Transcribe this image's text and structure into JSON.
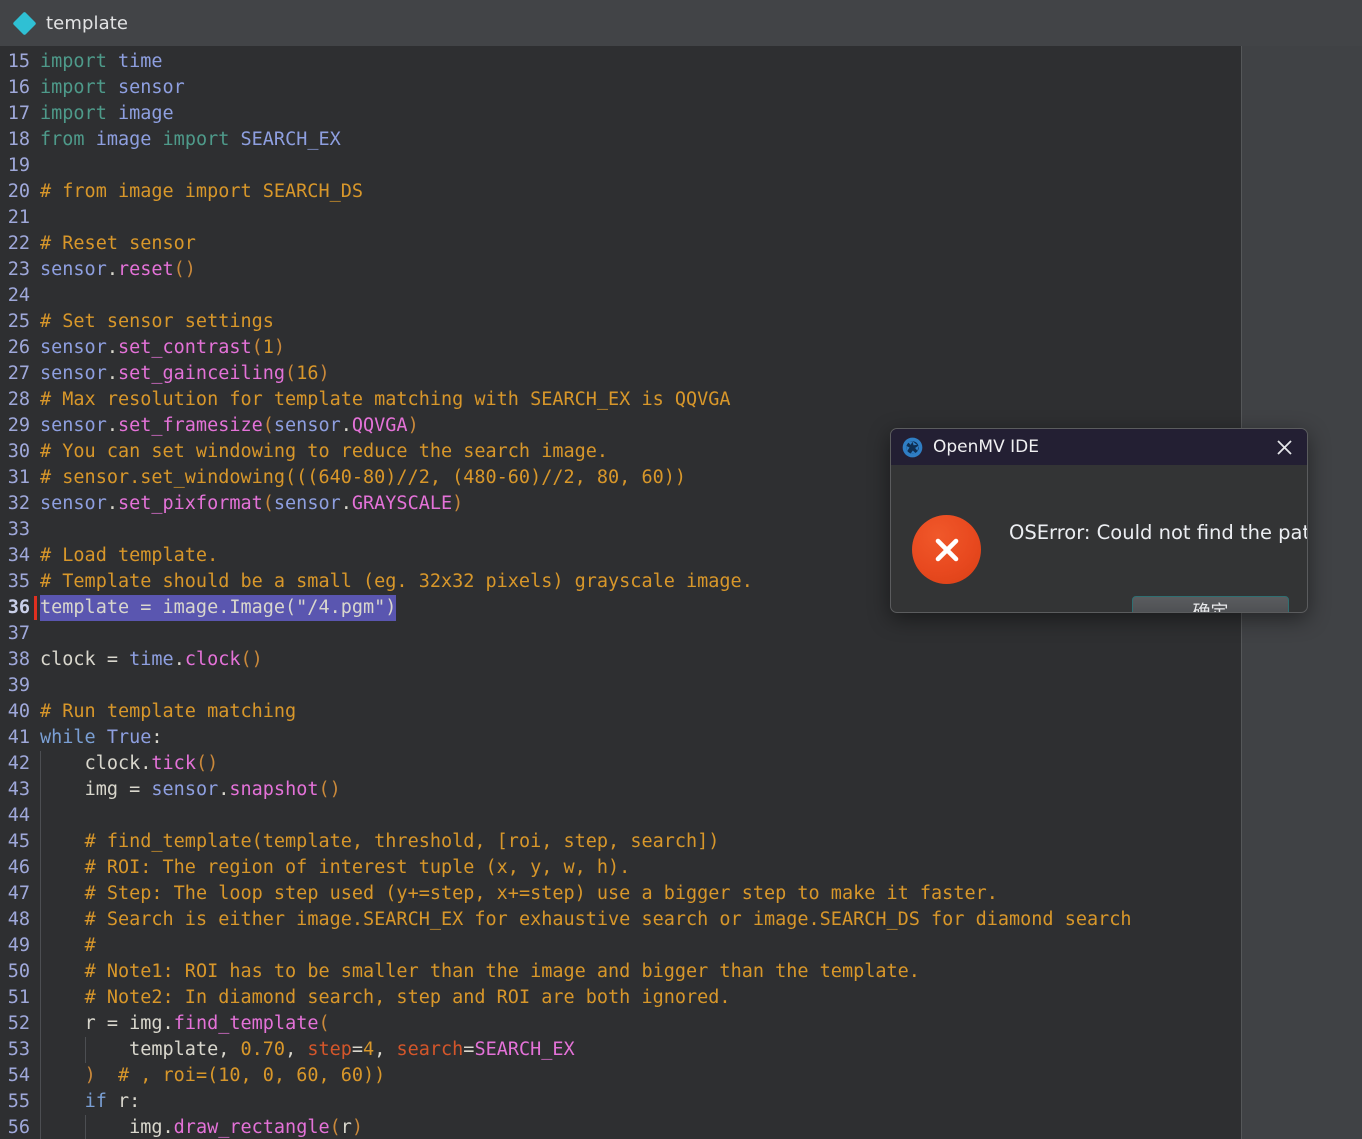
{
  "tab": {
    "label": "template",
    "icon": "diamond-icon",
    "accent_color": "#2fc0d4"
  },
  "editor": {
    "first_line_number": 15,
    "current_line": 36,
    "selection_color": "#5a56b0",
    "background": "#2e2f31",
    "lines": [
      {
        "n": 15,
        "tokens": [
          {
            "t": "import",
            "c": "t-kw"
          },
          {
            "t": " ",
            "c": "t-plain"
          },
          {
            "t": "time",
            "c": "t-mod"
          }
        ]
      },
      {
        "n": 16,
        "tokens": [
          {
            "t": "import",
            "c": "t-kw"
          },
          {
            "t": " ",
            "c": "t-plain"
          },
          {
            "t": "sensor",
            "c": "t-mod"
          }
        ]
      },
      {
        "n": 17,
        "tokens": [
          {
            "t": "import",
            "c": "t-kw"
          },
          {
            "t": " ",
            "c": "t-plain"
          },
          {
            "t": "image",
            "c": "t-mod"
          }
        ]
      },
      {
        "n": 18,
        "tokens": [
          {
            "t": "from",
            "c": "t-kw"
          },
          {
            "t": " ",
            "c": "t-plain"
          },
          {
            "t": "image",
            "c": "t-mod"
          },
          {
            "t": " ",
            "c": "t-plain"
          },
          {
            "t": "import",
            "c": "t-kw"
          },
          {
            "t": " ",
            "c": "t-plain"
          },
          {
            "t": "SEARCH_EX",
            "c": "t-mod"
          }
        ]
      },
      {
        "n": 19,
        "tokens": []
      },
      {
        "n": 20,
        "tokens": [
          {
            "t": "# from image import SEARCH_DS",
            "c": "t-com"
          }
        ]
      },
      {
        "n": 21,
        "tokens": []
      },
      {
        "n": 22,
        "tokens": [
          {
            "t": "# Reset sensor",
            "c": "t-com"
          }
        ]
      },
      {
        "n": 23,
        "tokens": [
          {
            "t": "sensor",
            "c": "t-mod"
          },
          {
            "t": ".",
            "c": "t-plain"
          },
          {
            "t": "reset",
            "c": "t-meth"
          },
          {
            "t": "()",
            "c": "t-punc"
          }
        ]
      },
      {
        "n": 24,
        "tokens": []
      },
      {
        "n": 25,
        "tokens": [
          {
            "t": "# Set sensor settings",
            "c": "t-com"
          }
        ]
      },
      {
        "n": 26,
        "tokens": [
          {
            "t": "sensor",
            "c": "t-mod"
          },
          {
            "t": ".",
            "c": "t-plain"
          },
          {
            "t": "set_contrast",
            "c": "t-meth"
          },
          {
            "t": "(",
            "c": "t-punc"
          },
          {
            "t": "1",
            "c": "t-num"
          },
          {
            "t": ")",
            "c": "t-punc"
          }
        ]
      },
      {
        "n": 27,
        "tokens": [
          {
            "t": "sensor",
            "c": "t-mod"
          },
          {
            "t": ".",
            "c": "t-plain"
          },
          {
            "t": "set_gainceiling",
            "c": "t-meth"
          },
          {
            "t": "(",
            "c": "t-punc"
          },
          {
            "t": "16",
            "c": "t-num"
          },
          {
            "t": ")",
            "c": "t-punc"
          }
        ]
      },
      {
        "n": 28,
        "tokens": [
          {
            "t": "# Max resolution for template matching with SEARCH_EX is QQVGA",
            "c": "t-com"
          }
        ]
      },
      {
        "n": 29,
        "tokens": [
          {
            "t": "sensor",
            "c": "t-mod"
          },
          {
            "t": ".",
            "c": "t-plain"
          },
          {
            "t": "set_framesize",
            "c": "t-meth"
          },
          {
            "t": "(",
            "c": "t-punc"
          },
          {
            "t": "sensor",
            "c": "t-mod"
          },
          {
            "t": ".",
            "c": "t-plain"
          },
          {
            "t": "QQVGA",
            "c": "t-const"
          },
          {
            "t": ")",
            "c": "t-punc"
          }
        ]
      },
      {
        "n": 30,
        "tokens": [
          {
            "t": "# You can set windowing to reduce the search image.",
            "c": "t-com"
          }
        ]
      },
      {
        "n": 31,
        "tokens": [
          {
            "t": "# sensor.set_windowing(((640-80)//2, (480-60)//2, 80, 60))",
            "c": "t-com"
          }
        ]
      },
      {
        "n": 32,
        "tokens": [
          {
            "t": "sensor",
            "c": "t-mod"
          },
          {
            "t": ".",
            "c": "t-plain"
          },
          {
            "t": "set_pixformat",
            "c": "t-meth"
          },
          {
            "t": "(",
            "c": "t-punc"
          },
          {
            "t": "sensor",
            "c": "t-mod"
          },
          {
            "t": ".",
            "c": "t-plain"
          },
          {
            "t": "GRAYSCALE",
            "c": "t-const"
          },
          {
            "t": ")",
            "c": "t-punc"
          }
        ]
      },
      {
        "n": 33,
        "tokens": []
      },
      {
        "n": 34,
        "tokens": [
          {
            "t": "# Load template.",
            "c": "t-com"
          }
        ]
      },
      {
        "n": 35,
        "tokens": [
          {
            "t": "# Template should be a small (eg. 32x32 pixels) grayscale image.",
            "c": "t-com"
          }
        ]
      },
      {
        "n": 36,
        "selected": true,
        "tokens": [
          {
            "t": "template = image.Image(\"/4.pgm\")",
            "c": "t-plain"
          }
        ]
      },
      {
        "n": 37,
        "tokens": []
      },
      {
        "n": 38,
        "tokens": [
          {
            "t": "clock",
            "c": "t-var"
          },
          {
            "t": " = ",
            "c": "t-op"
          },
          {
            "t": "time",
            "c": "t-mod"
          },
          {
            "t": ".",
            "c": "t-plain"
          },
          {
            "t": "clock",
            "c": "t-meth"
          },
          {
            "t": "()",
            "c": "t-punc"
          }
        ]
      },
      {
        "n": 39,
        "tokens": []
      },
      {
        "n": 40,
        "tokens": [
          {
            "t": "# Run template matching",
            "c": "t-com"
          }
        ]
      },
      {
        "n": 41,
        "tokens": [
          {
            "t": "while",
            "c": "t-kw2"
          },
          {
            "t": " ",
            "c": "t-plain"
          },
          {
            "t": "True",
            "c": "t-bi"
          },
          {
            "t": ":",
            "c": "t-plain"
          }
        ]
      },
      {
        "n": 42,
        "indent": 1,
        "tokens": [
          {
            "t": "    ",
            "c": "t-plain"
          },
          {
            "t": "clock",
            "c": "t-var"
          },
          {
            "t": ".",
            "c": "t-plain"
          },
          {
            "t": "tick",
            "c": "t-meth"
          },
          {
            "t": "()",
            "c": "t-punc"
          }
        ]
      },
      {
        "n": 43,
        "indent": 1,
        "tokens": [
          {
            "t": "    ",
            "c": "t-plain"
          },
          {
            "t": "img",
            "c": "t-var"
          },
          {
            "t": " = ",
            "c": "t-op"
          },
          {
            "t": "sensor",
            "c": "t-mod"
          },
          {
            "t": ".",
            "c": "t-plain"
          },
          {
            "t": "snapshot",
            "c": "t-meth"
          },
          {
            "t": "()",
            "c": "t-punc"
          }
        ]
      },
      {
        "n": 44,
        "indent": 1,
        "tokens": []
      },
      {
        "n": 45,
        "indent": 1,
        "tokens": [
          {
            "t": "    ",
            "c": "t-plain"
          },
          {
            "t": "# find_template(template, threshold, [roi, step, search])",
            "c": "t-com"
          }
        ]
      },
      {
        "n": 46,
        "indent": 1,
        "tokens": [
          {
            "t": "    ",
            "c": "t-plain"
          },
          {
            "t": "# ROI: The region of interest tuple (x, y, w, h).",
            "c": "t-com"
          }
        ]
      },
      {
        "n": 47,
        "indent": 1,
        "tokens": [
          {
            "t": "    ",
            "c": "t-plain"
          },
          {
            "t": "# Step: The loop step used (y+=step, x+=step) use a bigger step to make it faster.",
            "c": "t-com"
          }
        ]
      },
      {
        "n": 48,
        "indent": 1,
        "tokens": [
          {
            "t": "    ",
            "c": "t-plain"
          },
          {
            "t": "# Search is either image.SEARCH_EX for exhaustive search or image.SEARCH_DS for diamond search",
            "c": "t-com"
          }
        ]
      },
      {
        "n": 49,
        "indent": 1,
        "tokens": [
          {
            "t": "    ",
            "c": "t-plain"
          },
          {
            "t": "#",
            "c": "t-com"
          }
        ]
      },
      {
        "n": 50,
        "indent": 1,
        "tokens": [
          {
            "t": "    ",
            "c": "t-plain"
          },
          {
            "t": "# Note1: ROI has to be smaller than the image and bigger than the template.",
            "c": "t-com"
          }
        ]
      },
      {
        "n": 51,
        "indent": 1,
        "tokens": [
          {
            "t": "    ",
            "c": "t-plain"
          },
          {
            "t": "# Note2: In diamond search, step and ROI are both ignored.",
            "c": "t-com"
          }
        ]
      },
      {
        "n": 52,
        "indent": 1,
        "tokens": [
          {
            "t": "    ",
            "c": "t-plain"
          },
          {
            "t": "r",
            "c": "t-var"
          },
          {
            "t": " = ",
            "c": "t-op"
          },
          {
            "t": "img",
            "c": "t-var"
          },
          {
            "t": ".",
            "c": "t-plain"
          },
          {
            "t": "find_template",
            "c": "t-meth"
          },
          {
            "t": "(",
            "c": "t-punc"
          }
        ]
      },
      {
        "n": 53,
        "indent": 2,
        "tokens": [
          {
            "t": "        ",
            "c": "t-plain"
          },
          {
            "t": "template",
            "c": "t-plain"
          },
          {
            "t": ", ",
            "c": "t-plain"
          },
          {
            "t": "0.70",
            "c": "t-num"
          },
          {
            "t": ", ",
            "c": "t-plain"
          },
          {
            "t": "step",
            "c": "t-arg"
          },
          {
            "t": "=",
            "c": "t-plain"
          },
          {
            "t": "4",
            "c": "t-num"
          },
          {
            "t": ", ",
            "c": "t-plain"
          },
          {
            "t": "search",
            "c": "t-arg"
          },
          {
            "t": "=",
            "c": "t-plain"
          },
          {
            "t": "SEARCH_EX",
            "c": "t-const"
          }
        ]
      },
      {
        "n": 54,
        "indent": 1,
        "tokens": [
          {
            "t": "    ",
            "c": "t-plain"
          },
          {
            "t": ")",
            "c": "t-punc"
          },
          {
            "t": "  ",
            "c": "t-plain"
          },
          {
            "t": "# , roi=(10, 0, 60, 60))",
            "c": "t-com"
          }
        ]
      },
      {
        "n": 55,
        "indent": 1,
        "tokens": [
          {
            "t": "    ",
            "c": "t-plain"
          },
          {
            "t": "if",
            "c": "t-kw2"
          },
          {
            "t": " ",
            "c": "t-plain"
          },
          {
            "t": "r",
            "c": "t-var"
          },
          {
            "t": ":",
            "c": "t-plain"
          }
        ]
      },
      {
        "n": 56,
        "indent": 2,
        "tokens": [
          {
            "t": "        ",
            "c": "t-plain"
          },
          {
            "t": "img",
            "c": "t-var"
          },
          {
            "t": ".",
            "c": "t-plain"
          },
          {
            "t": "draw_rectangle",
            "c": "t-meth"
          },
          {
            "t": "(",
            "c": "t-punc"
          },
          {
            "t": "r",
            "c": "t-var"
          },
          {
            "t": ")",
            "c": "t-punc"
          }
        ]
      }
    ]
  },
  "dialog": {
    "title": "OpenMV IDE",
    "logo_icon": "openmv-aperture-icon",
    "close_icon": "close-icon",
    "error_icon": "error-x-icon",
    "message": "OSError: Could not find the path",
    "ok_label": "确定",
    "error_color": "#e8491f",
    "titlebar_color": "#231f33",
    "ok_border_color": "#2f6f72"
  }
}
